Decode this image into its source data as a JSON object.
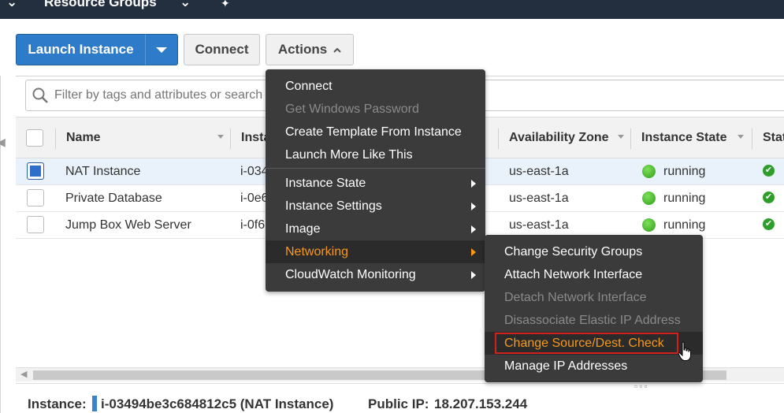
{
  "topbar": {
    "resource_groups": "Resource Groups",
    "chev": "⌄",
    "left_chev": "⌄",
    "pin": "✦"
  },
  "toolbar": {
    "launch_label": "Launch Instance",
    "connect_label": "Connect",
    "actions_label": "Actions",
    "actions_caret": "^"
  },
  "filter": {
    "placeholder": "Filter by tags and attributes or search"
  },
  "table": {
    "headers": {
      "name": "Name",
      "instance_id": "Insta",
      "az": "Availability Zone",
      "state": "Instance State",
      "status": "Stat"
    },
    "rows": [
      {
        "name": "NAT Instance",
        "id": "i-034",
        "az": "us-east-1a",
        "state": "running",
        "selected": true
      },
      {
        "name": "Private Database",
        "id": "i-0e6",
        "az": "us-east-1a",
        "state": "running",
        "selected": false
      },
      {
        "name": "Jump Box Web Server",
        "id": "i-0f6",
        "az": "us-east-1a",
        "state": "running",
        "selected": false
      }
    ],
    "status_check": "✔"
  },
  "actions_menu": {
    "items": [
      {
        "label": "Connect",
        "disabled": false
      },
      {
        "label": "Get Windows Password",
        "disabled": true
      },
      {
        "label": "Create Template From Instance",
        "disabled": false
      },
      {
        "label": "Launch More Like This",
        "disabled": false
      },
      {
        "label": "Instance State",
        "submenu": true
      },
      {
        "label": "Instance Settings",
        "submenu": true
      },
      {
        "label": "Image",
        "submenu": true
      },
      {
        "label": "Networking",
        "submenu": true,
        "active": true
      },
      {
        "label": "CloudWatch Monitoring",
        "submenu": true
      }
    ]
  },
  "networking_menu": {
    "items": [
      {
        "label": "Change Security Groups",
        "disabled": false
      },
      {
        "label": "Attach Network Interface",
        "disabled": false
      },
      {
        "label": "Detach Network Interface",
        "disabled": true
      },
      {
        "label": "Disassociate Elastic IP Address",
        "disabled": true
      },
      {
        "label": "Change Source/Dest. Check",
        "active": true
      },
      {
        "label": "Manage IP Addresses",
        "disabled": false
      }
    ]
  },
  "details": {
    "instance_label": "Instance:",
    "instance_value": "i-03494be3c684812c5 (NAT Instance)",
    "public_ip_label": "Public IP:",
    "public_ip_value": "18.207.153.244"
  },
  "colors": {
    "accent_orange": "#f7981d",
    "primary_blue": "#2e7bc9",
    "highlight_red": "#d0211b"
  }
}
